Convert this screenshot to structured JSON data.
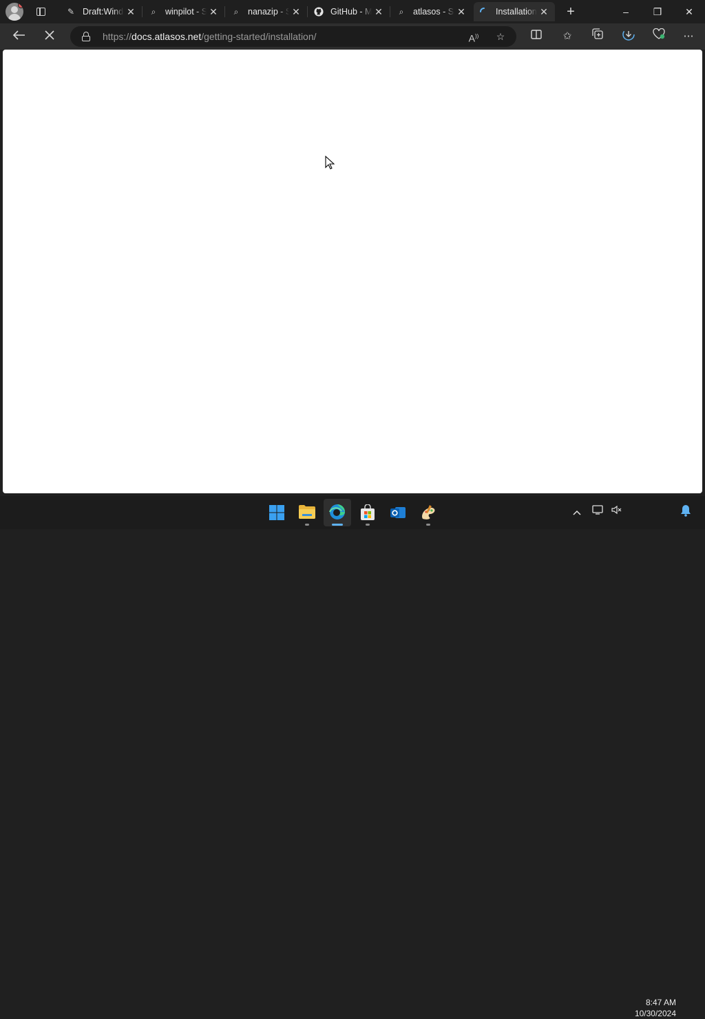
{
  "browser": {
    "tabs": [
      {
        "title": "Draft:Windows",
        "icon": "edit-icon"
      },
      {
        "title": "winpilot - Search",
        "icon": "search-icon"
      },
      {
        "title": "nanazip - Search",
        "icon": "search-icon"
      },
      {
        "title": "GitHub - M",
        "icon": "github-icon"
      },
      {
        "title": "atlasos - Search",
        "icon": "search-icon"
      },
      {
        "title": "Installation",
        "icon": "loading-icon",
        "active": true
      }
    ],
    "address": {
      "scheme": "https://",
      "host": "docs.atlasos.net",
      "path": "/getting-started/installation/"
    },
    "window_controls": {
      "minimize": "–",
      "restore": "❐",
      "close": "✕"
    }
  },
  "taskbar": {
    "apps": [
      "start",
      "file-explorer",
      "edge",
      "microsoft-store",
      "outlook",
      "paint"
    ],
    "clock": {
      "time": "8:47 AM",
      "date": "10/30/2024"
    }
  },
  "colors": {
    "accent": "#5fb2f2",
    "tabstrip": "#1f1f1f",
    "toolbar": "#2e2e2e"
  }
}
